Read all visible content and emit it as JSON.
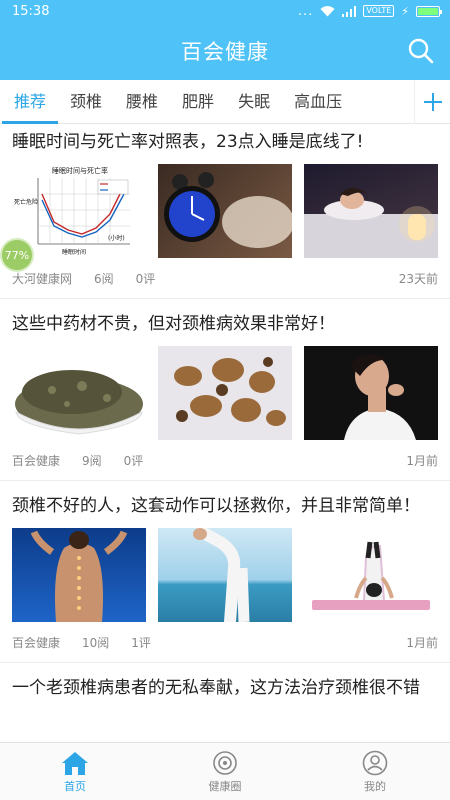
{
  "status_bar": {
    "time": "15:38",
    "network": "VOLTE",
    "dots": "..."
  },
  "header": {
    "title": "百会健康"
  },
  "tabs": [
    "推荐",
    "颈椎",
    "腰椎",
    "肥胖",
    "失眠",
    "高血压"
  ],
  "active_tab": 0,
  "progress_badge": {
    "value": "77%"
  },
  "articles": [
    {
      "title": "睡眠时间与死亡率对照表，23点入睡是底线了!",
      "source": "大河健康网",
      "reads": "6阅",
      "comments": "0评",
      "time": "23天前",
      "chart_thumb": {
        "title": "睡眠时间与死亡率",
        "ylabel": "死亡危险",
        "xlabel": "睡眠时间",
        "unit": "(小时)"
      }
    },
    {
      "title": "这些中药材不贵，但对颈椎病效果非常好！",
      "source": "百会健康",
      "reads": "9阅",
      "comments": "0评",
      "time": "1月前"
    },
    {
      "title": "颈椎不好的人，这套动作可以拯救你，并且非常简单！",
      "source": "百会健康",
      "reads": "10阅",
      "comments": "1评",
      "time": "1月前"
    },
    {
      "title": "一个老颈椎病患者的无私奉献，这方法治疗颈椎很不错"
    }
  ],
  "bottom_nav": [
    {
      "label": "首页",
      "icon": "home-icon",
      "active": true
    },
    {
      "label": "健康圈",
      "icon": "circle-icon",
      "active": false
    },
    {
      "label": "我的",
      "icon": "user-icon",
      "active": false
    }
  ],
  "colors": {
    "primary": "#4fc3f7",
    "accent": "#2ba5e5"
  }
}
